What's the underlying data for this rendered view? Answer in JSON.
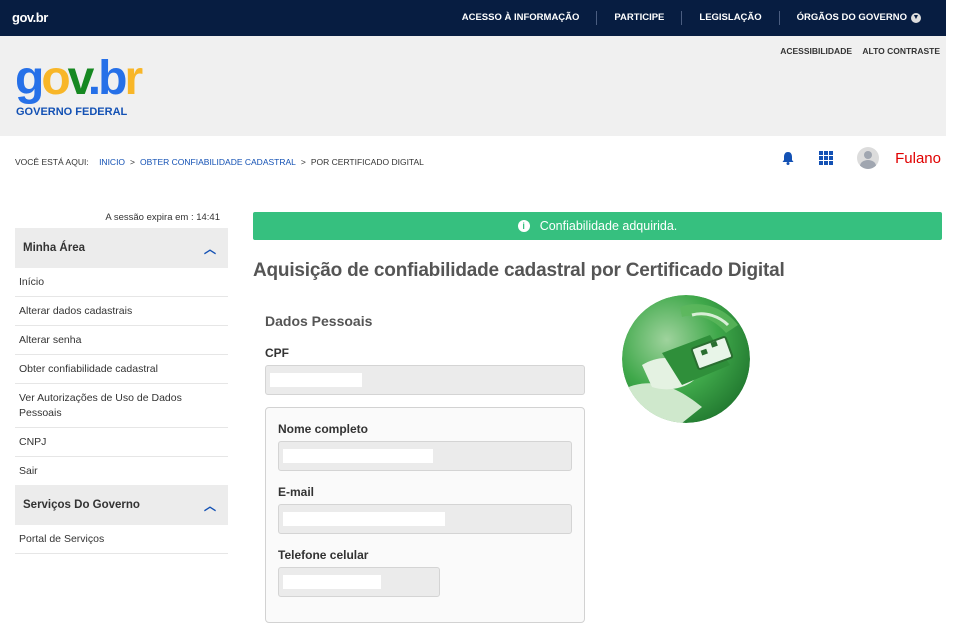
{
  "topbar": {
    "brand": "gov.br",
    "nav": [
      "ACESSO À INFORMAÇÃO",
      "PARTICIPE",
      "LEGISLAÇÃO",
      "ÓRGÃOS DO GOVERNO"
    ],
    "bg_color": "#071d41"
  },
  "header": {
    "logo_text": "gov.br",
    "subtitle": "GOVERNO FEDERAL",
    "accessibility": "ACESSIBILIDADE",
    "high_contrast": "ALTO CONTRASTE"
  },
  "breadcrumb": {
    "label": "VOCÊ ESTÁ AQUI:",
    "items": [
      "INICIO",
      "OBTER CONFIABILIDADE CADASTRAL",
      "POR CERTIFICADO DIGITAL"
    ],
    "separator": ">"
  },
  "user": {
    "name": "Fulano",
    "icons": [
      "bell-icon",
      "apps-grid-icon",
      "avatar"
    ]
  },
  "sidebar": {
    "session": "A sessão expira em : 14:41",
    "section1": {
      "title": "Minha Área",
      "items": [
        "Início",
        "Alterar dados cadastrais",
        "Alterar senha",
        "Obter confiabilidade cadastral",
        "Ver Autorizações de Uso de Dados Pessoais",
        "CNPJ",
        "Sair"
      ]
    },
    "section2": {
      "title": "Serviços Do Governo",
      "items": [
        "Portal de Serviços"
      ]
    }
  },
  "main": {
    "alert": "Confiabilidade adquirida.",
    "alert_color": "#36c07f",
    "title": "Aquisição de confiabilidade cadastral por Certificado Digital",
    "section": "Dados Pessoais",
    "fields": {
      "cpf": "CPF",
      "name": "Nome completo",
      "email": "E-mail",
      "phone": "Telefone celular"
    }
  }
}
